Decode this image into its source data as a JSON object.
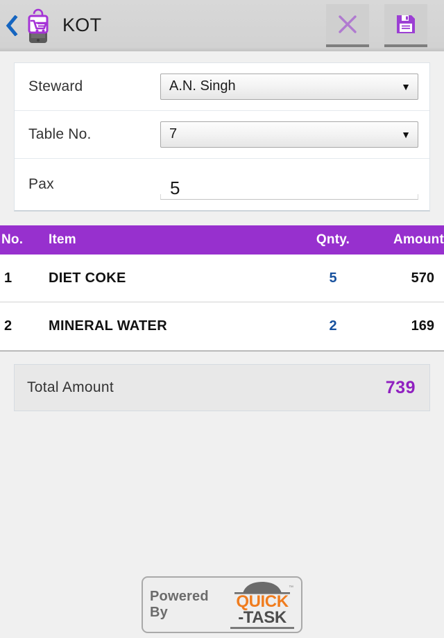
{
  "appbar": {
    "back_icon": "chevron-left-icon",
    "app_icon": "shopping-cart-app-icon",
    "title": "KOT",
    "close_label": "close-icon",
    "save_label": "save-icon"
  },
  "form": {
    "rows": [
      {
        "label": "Steward",
        "value": "A.N. Singh",
        "type": "select",
        "caret": "▼"
      },
      {
        "label": "Table No.",
        "value": "7",
        "type": "select",
        "caret": "▼"
      },
      {
        "label": "Pax",
        "value": "5",
        "type": "input"
      }
    ]
  },
  "table": {
    "headers": {
      "no": "No.",
      "item": "Item",
      "qty": "Qnty.",
      "amount": "Amount"
    },
    "rows": [
      {
        "no": "1",
        "item": "DIET COKE",
        "qty": "5",
        "amount": "570"
      },
      {
        "no": "2",
        "item": "MINERAL  WATER",
        "qty": "2",
        "amount": "169"
      }
    ]
  },
  "total": {
    "label": "Total Amount",
    "value": "739"
  },
  "footer": {
    "powered_by": "Powered By",
    "brand_primary": "QUICK",
    "brand_secondary": "-TASK",
    "trademark": "™"
  },
  "colors": {
    "accent_purple": "#9730ce",
    "total_purple": "#9020c0",
    "qty_blue": "#17519e",
    "brand_orange": "#f07c1e",
    "appbar_gray": "#d4d4d4",
    "page_bg": "#f0f0f0"
  }
}
